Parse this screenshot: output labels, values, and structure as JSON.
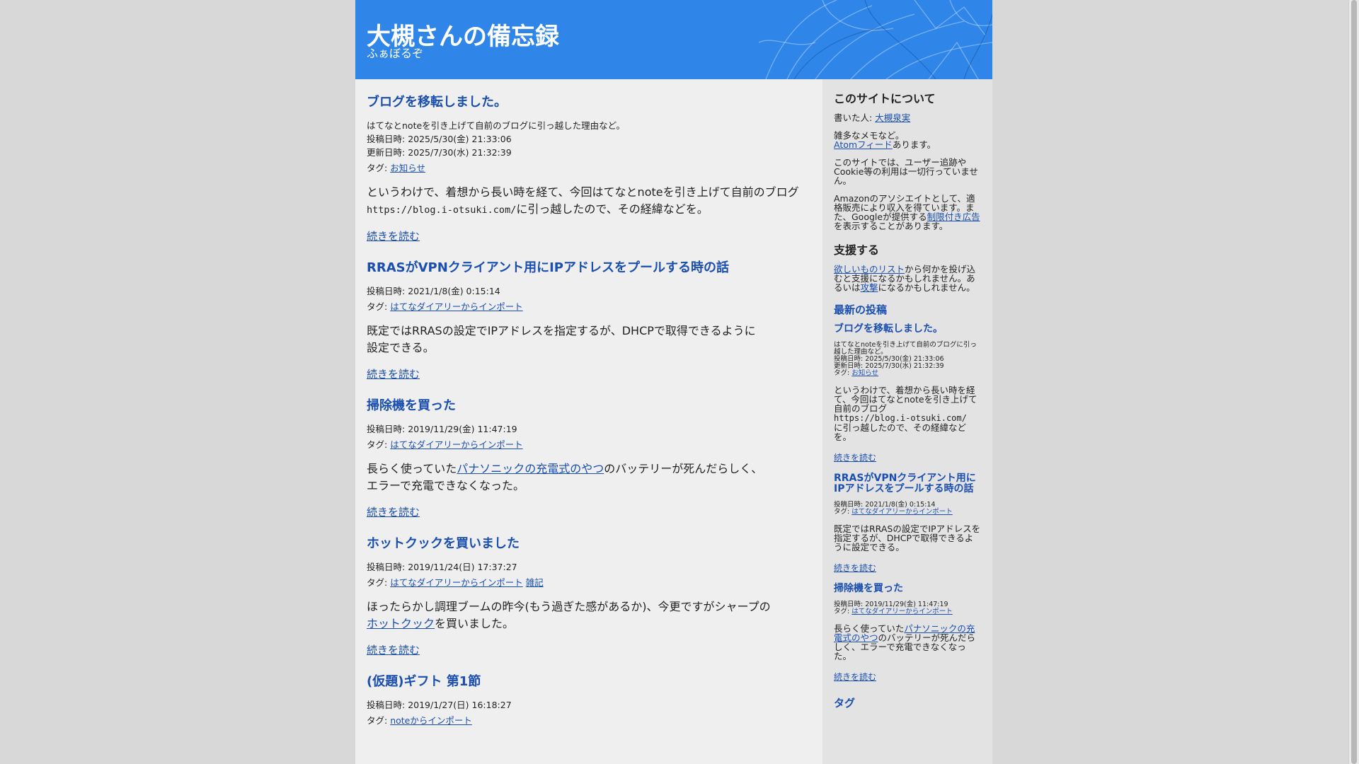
{
  "site": {
    "title": "大槻さんの備忘録",
    "subtitle": "ふぁぼるぞ"
  },
  "labels": {
    "posted": "投稿日時: ",
    "updated": "更新日時: ",
    "tags": "タグ: ",
    "read_more": "続きを読む"
  },
  "posts": [
    {
      "title": "ブログを移転しました。",
      "description": "はてなとnoteを引き上げて自前のブログに引っ越した理由など。",
      "posted": "2025/5/30(金) 21:33:06",
      "updated": "2025/7/30(水) 21:32:39",
      "tags": [
        "お知らせ"
      ],
      "body_a": "というわけで、着想から長い時を経て、今回はてなとnoteを引き上げて自前のブログ",
      "body_code": "https://blog.i-otsuki.com/",
      "body_b": "に引っ越したので、その経緯などを。"
    },
    {
      "title": "RRASがVPNクライアント用にIPアドレスをプールする時の話",
      "posted": "2021/1/8(金) 0:15:14",
      "tags": [
        "はてなダイアリーからインポート"
      ],
      "body_a": "既定ではRRASの設定でIPアドレスを指定するが、DHCPで取得できるように",
      "body_b": "設定できる。"
    },
    {
      "title": "掃除機を買った",
      "posted": "2019/11/29(金) 11:47:19",
      "tags": [
        "はてなダイアリーからインポート"
      ],
      "body_a": "長らく使っていた",
      "body_link": "パナソニックの充電式のやつ",
      "body_b": "のバッテリーが死んだらしく、",
      "body_c": "エラーで充電できなくなった。"
    },
    {
      "title": "ホットクックを買いました",
      "posted": "2019/11/24(日) 17:37:27",
      "tags": [
        "はてなダイアリーからインポート",
        "雑記"
      ],
      "body_a": "ほったらかし調理ブームの昨今(もう過ぎた感があるか)、今更ですがシャープの",
      "body_link": "ホットクック",
      "body_b": "を買いました。"
    },
    {
      "title": "(仮題)ギフト 第1節",
      "posted": "2019/1/27(日) 16:18:27",
      "tags": [
        "noteからインポート"
      ]
    }
  ],
  "sidebar": {
    "about_title": "このサイトについて",
    "author_label": "書いた人: ",
    "author_name": "大槻泉実",
    "misc_a": "雑多なメモなど。",
    "atom_link": "Atomフィード",
    "misc_b": "あります。",
    "privacy": "このサイトでは、ユーザー追跡やCookie等の利用は一切行っていません。",
    "amazon": "Amazonのアソシエイトとして、適格販売により収入を得ています。また、Googleが提供する",
    "ads_link": "制限付き広告",
    "ads_b": "を表示することがあります。",
    "support_title": "支援する",
    "wishlist_link": "欲しいものリスト",
    "support_a": "から何かを投げ込むと支援になるかもしれません。あるいは",
    "attack_link": "攻撃",
    "support_b": "になるかもしれません。",
    "recent_title": "最新の投稿",
    "tags_title": "タグ"
  }
}
